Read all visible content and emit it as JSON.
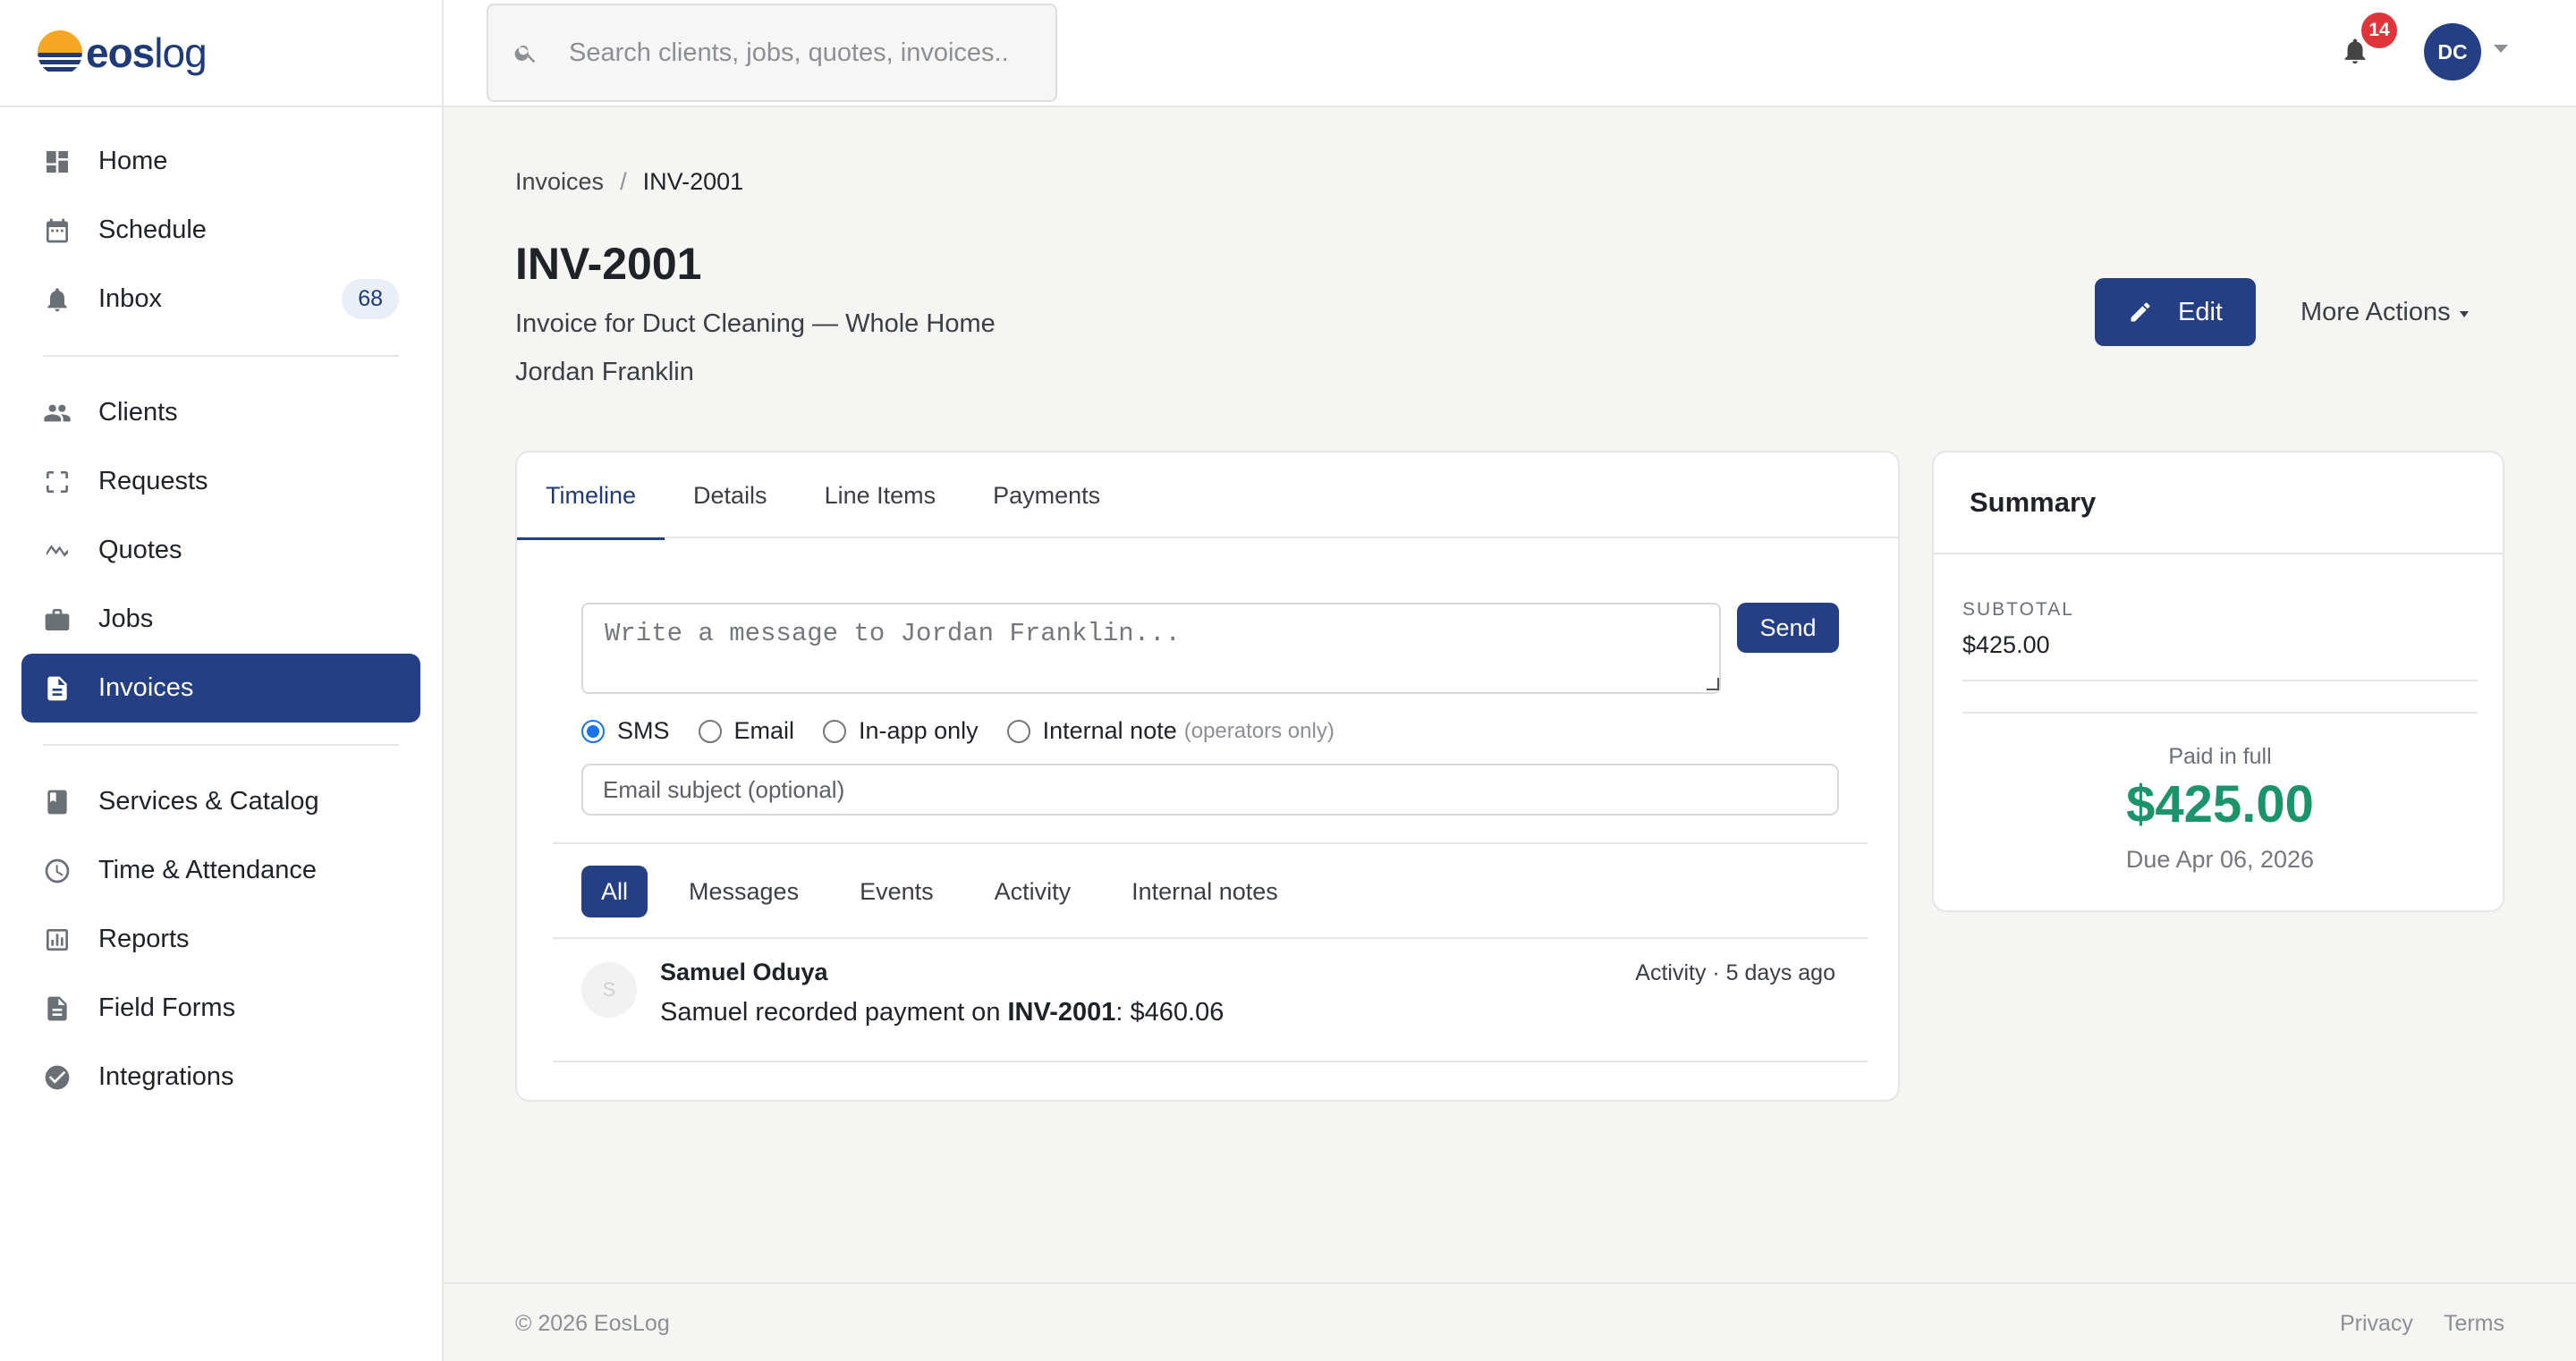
{
  "brand": {
    "name_bold": "eos",
    "name_light": "log"
  },
  "sidebar": {
    "items": [
      {
        "label": "Home",
        "icon": "dashboard-icon"
      },
      {
        "label": "Schedule",
        "icon": "calendar-icon"
      },
      {
        "label": "Inbox",
        "icon": "bell-icon",
        "count": "68"
      },
      {
        "label": "Clients",
        "icon": "people-icon"
      },
      {
        "label": "Requests",
        "icon": "request-icon"
      },
      {
        "label": "Quotes",
        "icon": "quotes-icon"
      },
      {
        "label": "Jobs",
        "icon": "briefcase-icon"
      },
      {
        "label": "Invoices",
        "icon": "document-icon",
        "active": true
      },
      {
        "label": "Services & Catalog",
        "icon": "book-icon"
      },
      {
        "label": "Time & Attendance",
        "icon": "clock-icon"
      },
      {
        "label": "Reports",
        "icon": "chart-icon"
      },
      {
        "label": "Field Forms",
        "icon": "form-icon"
      },
      {
        "label": "Integrations",
        "icon": "check-circle-icon"
      }
    ]
  },
  "topbar": {
    "search_placeholder": "Search clients, jobs, quotes, invoices..",
    "notification_count": "14",
    "user_initials": "DC"
  },
  "breadcrumb": {
    "parent": "Invoices",
    "separator": "/",
    "current": "INV-2001"
  },
  "invoice": {
    "title": "INV-2001",
    "subtitle": "Invoice for Duct Cleaning — Whole Home",
    "client": "Jordan Franklin"
  },
  "actions": {
    "edit_label": "Edit",
    "more_label": "More Actions"
  },
  "tabs": [
    "Timeline",
    "Details",
    "Line Items",
    "Payments"
  ],
  "composer": {
    "placeholder": "Write a message to Jordan Franklin...",
    "send_label": "Send",
    "channels": [
      "SMS",
      "Email",
      "In-app only",
      "Internal note"
    ],
    "internal_note_hint": "(operators only)",
    "subject_placeholder": "Email subject (optional)"
  },
  "filters": [
    "All",
    "Messages",
    "Events",
    "Activity",
    "Internal notes"
  ],
  "timeline_entry": {
    "avatar_initial": "S",
    "author": "Samuel Oduya",
    "meta": "Activity · 5 days ago",
    "text_before": "Samuel recorded payment on ",
    "invoice_ref": "INV-2001",
    "text_after": ": $460.06"
  },
  "summary": {
    "title": "Summary",
    "subtotal_label": "SUBTOTAL",
    "subtotal_value": "$425.00",
    "status_label": "Paid in full",
    "total": "$425.00",
    "due": "Due Apr 06, 2026"
  },
  "footer": {
    "copyright": "© 2026 EosLog",
    "privacy": "Privacy",
    "terms": "Terms"
  },
  "colors": {
    "primary": "#243f83",
    "paid": "#1c9469",
    "badge": "#e0343b"
  }
}
